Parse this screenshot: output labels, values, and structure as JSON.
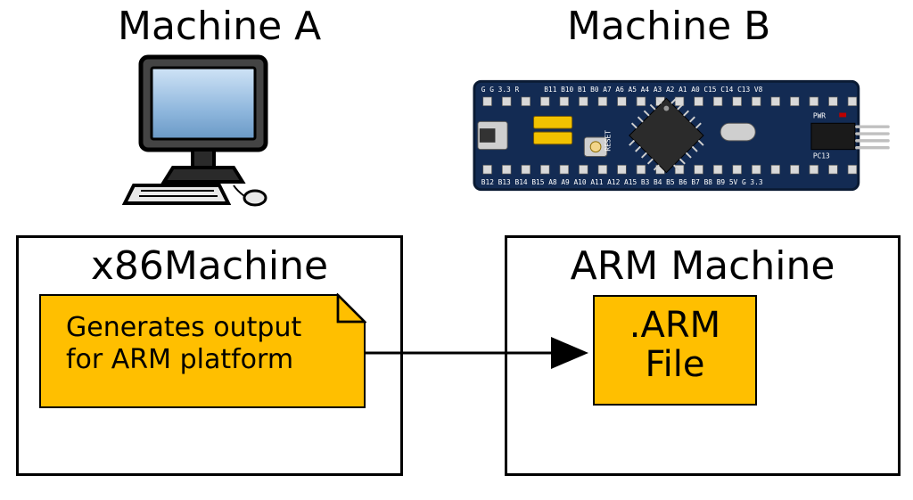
{
  "titles": {
    "machine_a": "Machine A",
    "machine_b": "Machine B"
  },
  "boxes": {
    "x86": "x86Machine",
    "arm": "ARM Machine"
  },
  "note": {
    "line1": "Generates output",
    "line2": "for ARM platform"
  },
  "file": {
    "line1": ".ARM",
    "line2": "File"
  },
  "colors": {
    "note_fill": "#ffbf00",
    "board_blue": "#132b53",
    "board_silk": "#ffffff",
    "chip": "#2b2b2b"
  },
  "icons": {
    "computer": "desktop-computer-icon",
    "board": "arm-microcontroller-board-icon"
  }
}
